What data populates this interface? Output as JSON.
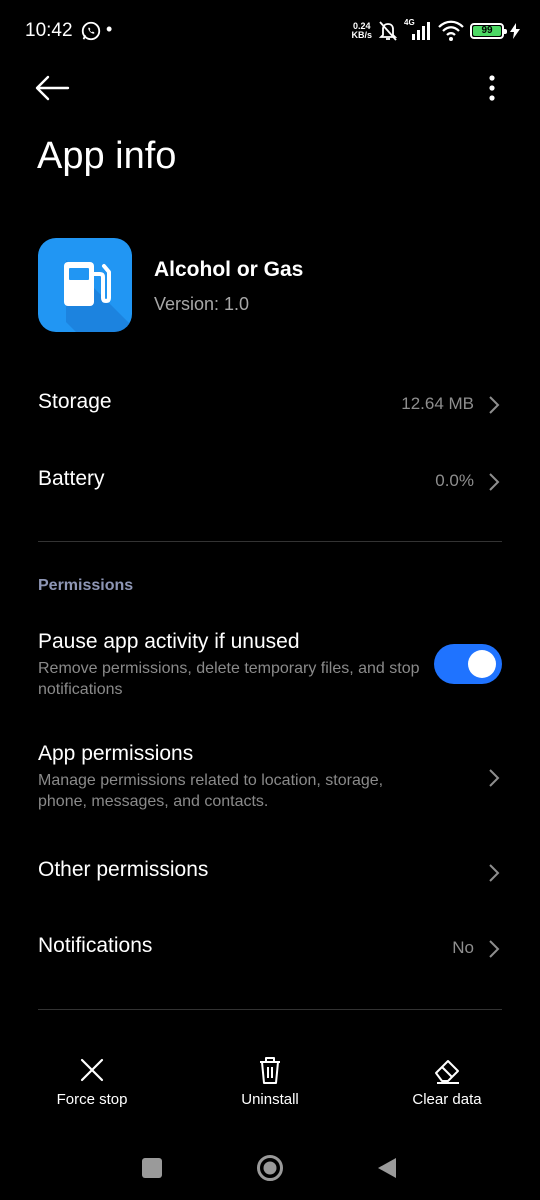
{
  "status_bar": {
    "time": "10:42",
    "net_speed_value": "0.24",
    "net_speed_unit": "KB/s",
    "network_type": "4G",
    "battery_level": "99",
    "battery_fraction": 0.99,
    "battery_color": "#4cd964"
  },
  "page": {
    "title": "App info"
  },
  "app": {
    "name": "Alcohol or Gas",
    "version": "Version: 1.0",
    "icon_color": "#2196f3",
    "icon": "fuel-pump-icon"
  },
  "rows": {
    "storage": {
      "label": "Storage",
      "value": "12.64 MB"
    },
    "battery": {
      "label": "Battery",
      "value": "0.0%"
    }
  },
  "permissions": {
    "section_title": "Permissions",
    "pause": {
      "label": "Pause app activity if unused",
      "description": "Remove permissions, delete temporary files, and stop notifications",
      "enabled": true,
      "toggle_color": "#1f73ff"
    },
    "app_permissions": {
      "label": "App permissions",
      "description": "Manage permissions related to location, storage, phone, messages, and contacts."
    },
    "other_permissions": {
      "label": "Other permissions"
    },
    "notifications": {
      "label": "Notifications",
      "value": "No"
    }
  },
  "actions": {
    "force_stop": {
      "label": "Force stop",
      "icon": "close-icon"
    },
    "uninstall": {
      "label": "Uninstall",
      "icon": "trash-icon"
    },
    "clear_data": {
      "label": "Clear data",
      "icon": "eraser-icon"
    }
  }
}
